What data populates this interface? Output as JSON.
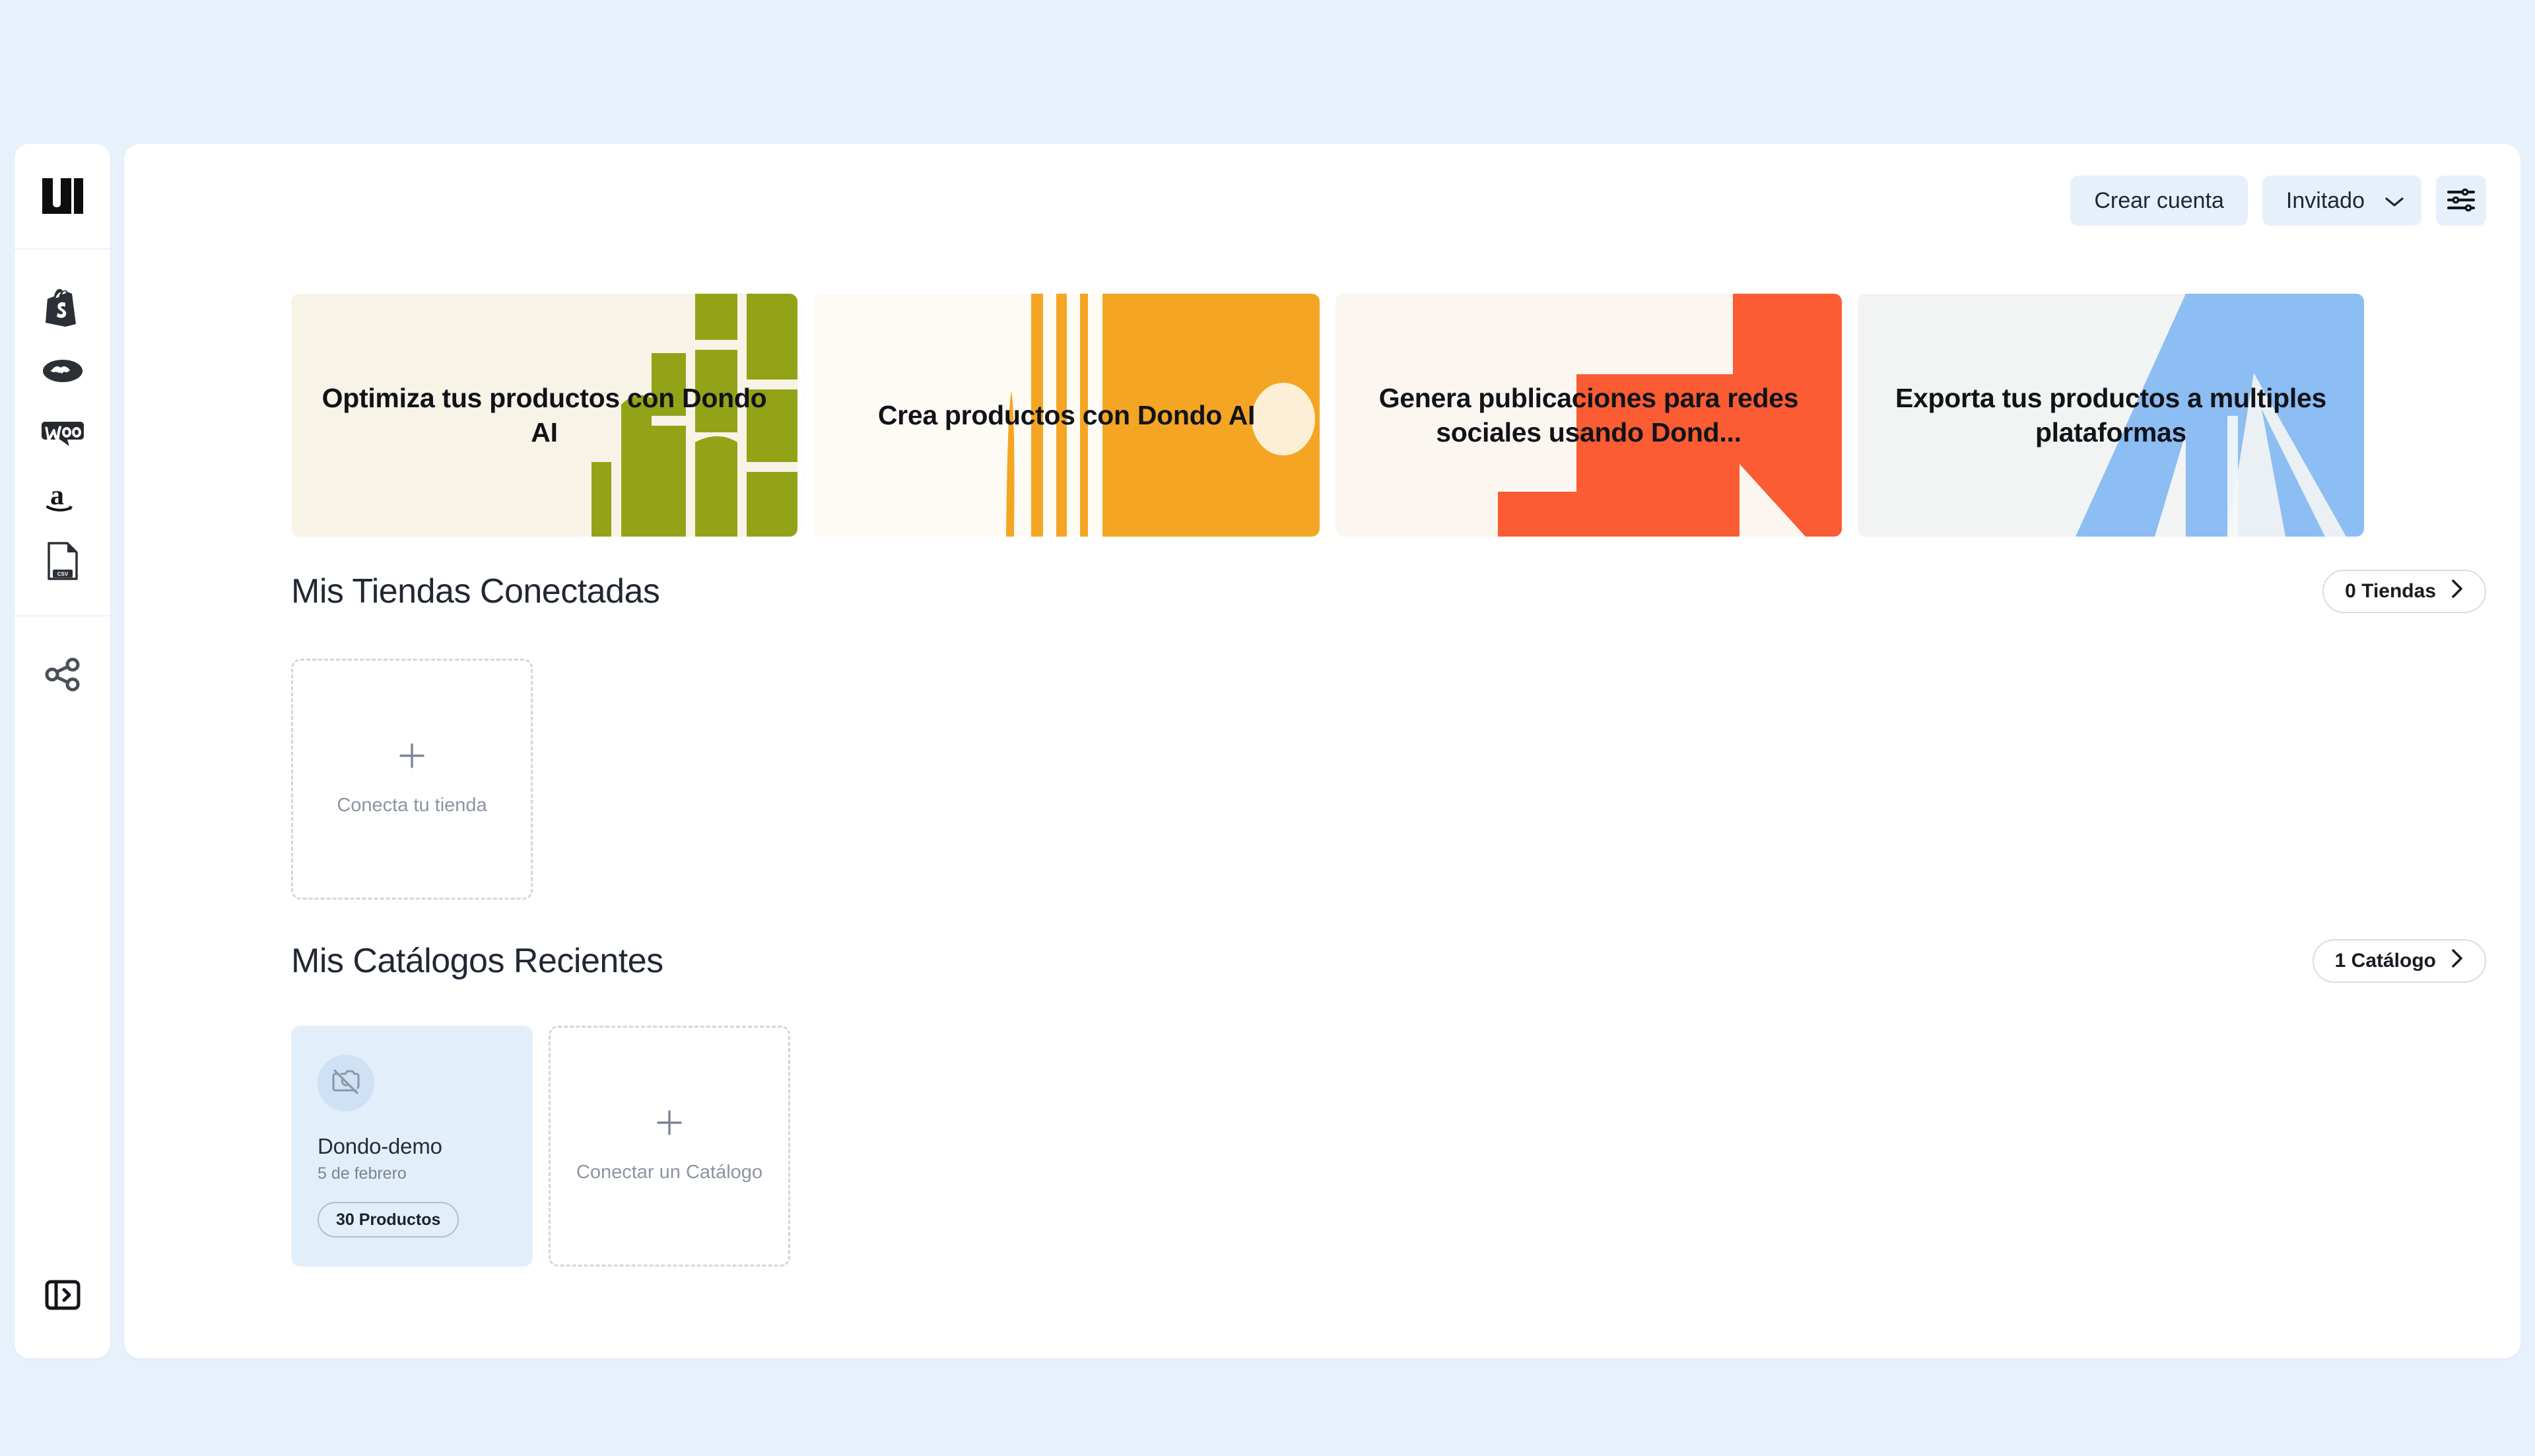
{
  "theme": {
    "page_background": "#e7f1fc",
    "panel_background": "#ffffff",
    "accent_button_bg": "#e6f0fb",
    "catalog_card_bg": "#e3eefb"
  },
  "sidebar": {
    "logo_name": "dondo-logo",
    "channels": [
      {
        "name": "shopify",
        "label": "Shopify"
      },
      {
        "name": "mercadolibre",
        "label": "MercadoLibre"
      },
      {
        "name": "woocommerce",
        "label": "WooCommerce"
      },
      {
        "name": "amazon",
        "label": "Amazon"
      },
      {
        "name": "csv",
        "label": "CSV"
      }
    ],
    "tools": [
      {
        "name": "share",
        "label": "Compartir"
      }
    ],
    "collapse_toggle": "panel-expand"
  },
  "header": {
    "create_account_label": "Crear cuenta",
    "account_label": "Invitado",
    "chevron": "⌄",
    "settings_icon": "sliders-icon"
  },
  "banners": [
    {
      "title": "Optimiza tus productos con Dondo AI",
      "accent": "#93a318",
      "base": "#f7f3e7"
    },
    {
      "title": "Crea productos con Dondo AI",
      "accent": "#f5a524",
      "base": "#fdfbf4"
    },
    {
      "title": "Genera publicaciones para redes sociales usando Dond...",
      "accent": "#fb5c33",
      "base": "#fbf7f0"
    },
    {
      "title": "Exporta tus productos a multiples plataformas",
      "accent": "#8cbdf3",
      "base": "#f2f4f3"
    }
  ],
  "stores_section": {
    "title": "Mis Tiendas Conectadas",
    "count_pill": "0 Tiendas",
    "connect_card_label": "Conecta tu tienda",
    "plus_glyph": "+"
  },
  "catalogs_section": {
    "title": "Mis Catálogos Recientes",
    "count_pill": "1 Catálogo",
    "connect_card_label": "Conectar un Catálogo",
    "plus_glyph": "+",
    "items": [
      {
        "name": "Dondo-demo",
        "date": "5 de febrero",
        "products_pill": "30 Productos",
        "thumbnail_icon": "image-off-icon"
      }
    ]
  }
}
